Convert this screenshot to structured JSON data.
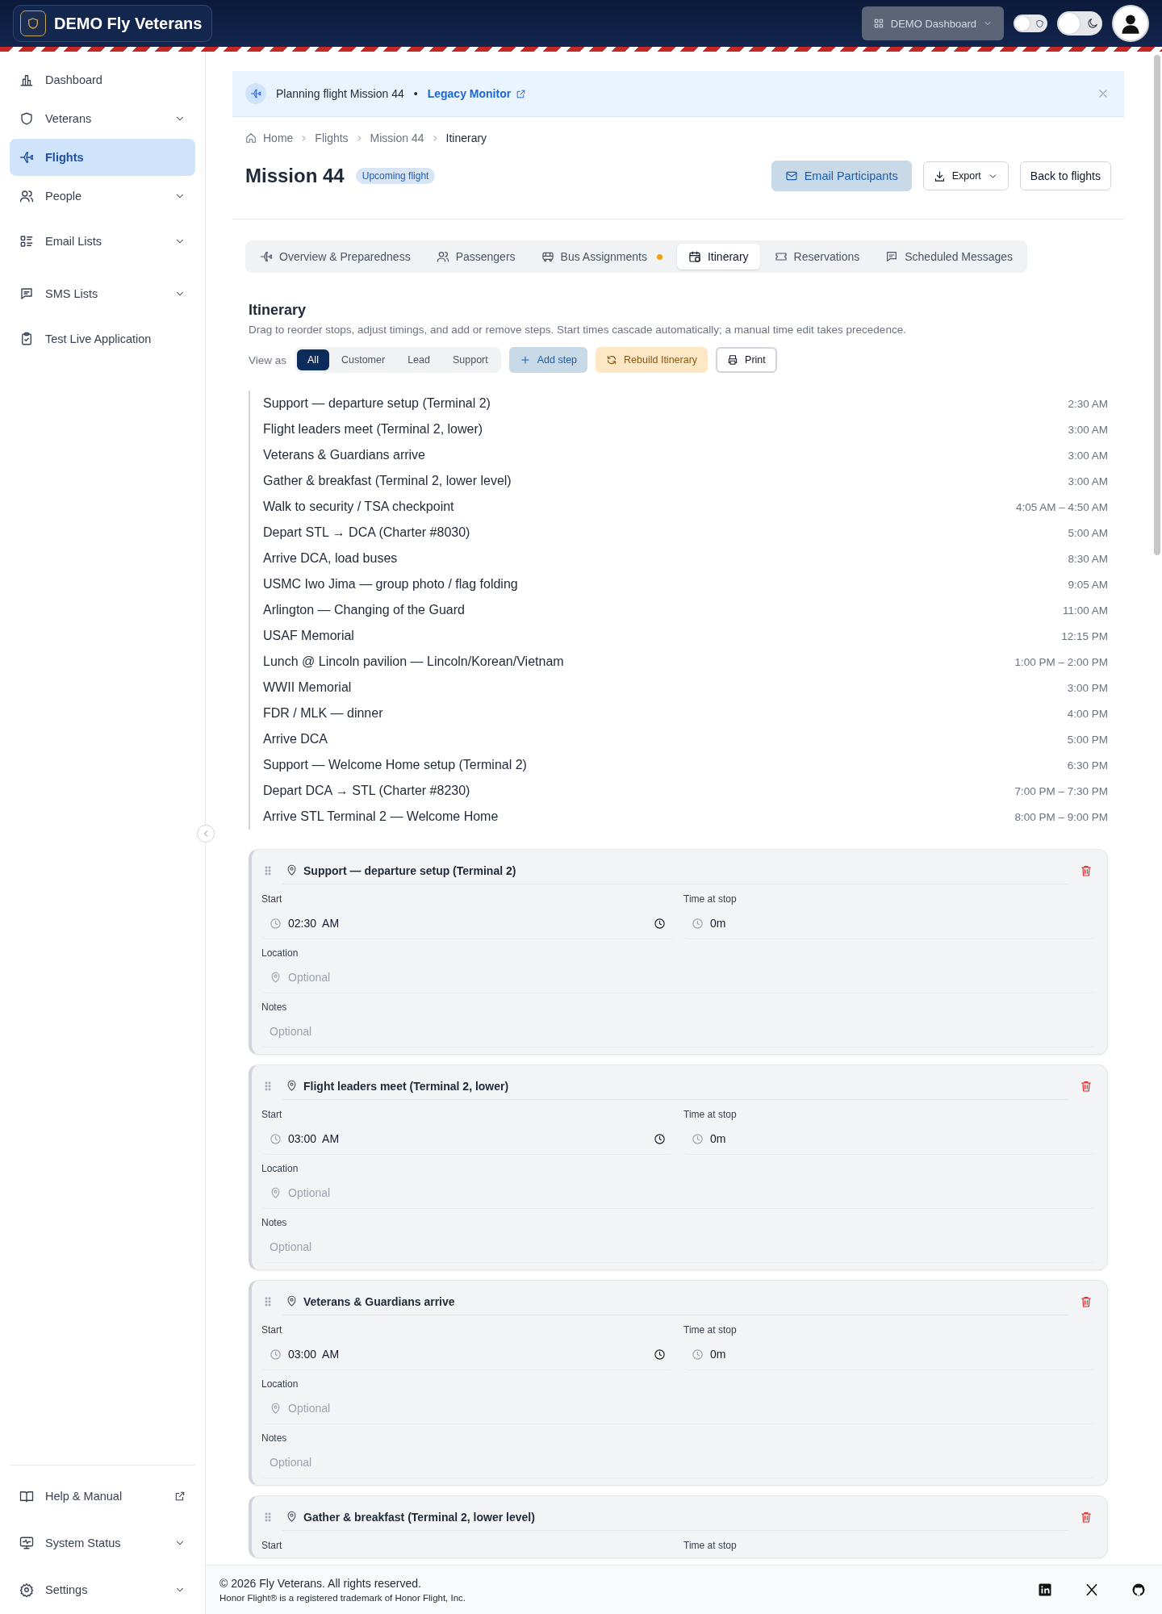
{
  "header": {
    "brand": "DEMO Fly Veterans",
    "dashboard_button": {
      "label": "DEMO Dashboard",
      "disabled": true
    },
    "toggles": [
      {
        "kind": "contrast",
        "on": false
      },
      {
        "kind": "dark",
        "on": false
      }
    ]
  },
  "sidebar": {
    "items": [
      {
        "label": "Dashboard",
        "selected": false,
        "expandable": false
      },
      {
        "label": "Veterans",
        "selected": false,
        "expandable": true
      },
      {
        "label": "Flights",
        "selected": true,
        "expandable": false
      },
      {
        "label": "People",
        "selected": false,
        "expandable": true
      },
      {
        "label": "Email Lists",
        "selected": false,
        "expandable": true
      },
      {
        "label": "SMS Lists",
        "selected": false,
        "expandable": true
      },
      {
        "label": "Test Live Application",
        "selected": false,
        "expandable": false
      }
    ],
    "bottom_items": [
      {
        "label": "Help & Manual",
        "external": true,
        "expandable": false
      },
      {
        "label": "System Status",
        "external": false,
        "expandable": true
      },
      {
        "label": "Settings",
        "external": false,
        "expandable": true
      }
    ]
  },
  "banner": {
    "text": "Planning flight Mission 44",
    "separator": "•",
    "link": "Legacy Monitor"
  },
  "breadcrumb": [
    "Home",
    "Flights",
    "Mission 44",
    "Itinerary"
  ],
  "page": {
    "title": "Mission 44",
    "status": "Upcoming flight",
    "buttons": [
      {
        "kind": "primary",
        "label": "Email Participants"
      },
      {
        "kind": "menu",
        "label": "Export"
      },
      {
        "kind": "plain",
        "label": "Back to flights"
      }
    ]
  },
  "tabs": [
    {
      "label": "Overview & Preparedness",
      "selected": false,
      "dot": false
    },
    {
      "label": "Passengers",
      "selected": false,
      "dot": false
    },
    {
      "label": "Bus Assignments",
      "selected": false,
      "dot": true
    },
    {
      "label": "Itinerary",
      "selected": true,
      "dot": false
    },
    {
      "label": "Reservations",
      "selected": false,
      "dot": false
    },
    {
      "label": "Scheduled Messages",
      "selected": false,
      "dot": false
    }
  ],
  "itinerary": {
    "title": "Itinerary",
    "description": "Drag to reorder stops, adjust timings, and add or remove steps. Start times cascade automatically; a manual time edit takes precedence.",
    "view_as_label": "View as",
    "view_options": [
      {
        "label": "All",
        "selected": true
      },
      {
        "label": "Customer",
        "selected": false
      },
      {
        "label": "Lead",
        "selected": false
      },
      {
        "label": "Support",
        "selected": false
      }
    ],
    "actions": [
      {
        "kind": "add",
        "label": "Add step"
      },
      {
        "kind": "rebuild",
        "label": "Rebuild Itinerary"
      },
      {
        "kind": "print",
        "label": "Print"
      }
    ],
    "stops": [
      {
        "name": "Support — departure setup (Terminal 2)",
        "time": "2:30 AM"
      },
      {
        "name": "Flight leaders meet (Terminal 2, lower)",
        "time": "3:00 AM"
      },
      {
        "name": "Veterans & Guardians arrive",
        "time": "3:00 AM"
      },
      {
        "name": "Gather & breakfast (Terminal 2, lower level)",
        "time": "3:00 AM"
      },
      {
        "name": "Walk to security / TSA checkpoint",
        "time": "4:05 AM – 4:50 AM"
      },
      {
        "name": "Depart STL → DCA (Charter #8030)",
        "time": "5:00 AM"
      },
      {
        "name": "Arrive DCA, load buses",
        "time": "8:30 AM"
      },
      {
        "name": "USMC Iwo Jima — group photo / flag folding",
        "time": "9:05 AM"
      },
      {
        "name": "Arlington — Changing of the Guard",
        "time": "11:00 AM"
      },
      {
        "name": "USAF Memorial",
        "time": "12:15 PM"
      },
      {
        "name": "Lunch @ Lincoln pavilion — Lincoln/Korean/Vietnam",
        "time": "1:00 PM – 2:00 PM"
      },
      {
        "name": "WWII Memorial",
        "time": "3:00 PM"
      },
      {
        "name": "FDR / MLK — dinner",
        "time": "4:00 PM"
      },
      {
        "name": "Arrive DCA",
        "time": "5:00 PM"
      },
      {
        "name": "Support — Welcome Home setup (Terminal 2)",
        "time": "6:30 PM"
      },
      {
        "name": "Depart DCA → STL (Charter #8230)",
        "time": "7:00 PM – 7:30 PM"
      },
      {
        "name": "Arrive STL Terminal 2 — Welcome Home",
        "time": "8:00 PM – 9:00 PM"
      }
    ],
    "cards": [
      {
        "title": "Support — departure setup (Terminal 2)",
        "fields": [
          {
            "kind": "time",
            "label": "Start",
            "value": "02:30  AM"
          },
          {
            "kind": "duration",
            "label": "Time at stop",
            "value": "0m"
          },
          {
            "kind": "location",
            "label": "Location",
            "placeholder": "Optional"
          },
          {
            "kind": "notes",
            "label": "Notes",
            "placeholder": "Optional"
          }
        ]
      },
      {
        "title": "Flight leaders meet (Terminal 2, lower)",
        "fields": [
          {
            "kind": "time",
            "label": "Start",
            "value": "03:00  AM"
          },
          {
            "kind": "duration",
            "label": "Time at stop",
            "value": "0m"
          },
          {
            "kind": "location",
            "label": "Location",
            "placeholder": "Optional"
          },
          {
            "kind": "notes",
            "label": "Notes",
            "placeholder": "Optional"
          }
        ]
      },
      {
        "title": "Veterans & Guardians arrive",
        "fields": [
          {
            "kind": "time",
            "label": "Start",
            "value": "03:00  AM"
          },
          {
            "kind": "duration",
            "label": "Time at stop",
            "value": "0m"
          },
          {
            "kind": "location",
            "label": "Location",
            "placeholder": "Optional"
          },
          {
            "kind": "notes",
            "label": "Notes",
            "placeholder": "Optional"
          }
        ]
      },
      {
        "title": "Gather & breakfast (Terminal 2, lower level)",
        "fields": [
          {
            "kind": "time",
            "label": "Start"
          },
          {
            "kind": "duration",
            "label": "Time at stop"
          }
        ]
      }
    ]
  },
  "footer": {
    "copyright": "© 2026 Fly Veterans. All rights reserved.",
    "trademark": "Honor Flight® is a registered trademark of Honor Flight, Inc."
  }
}
